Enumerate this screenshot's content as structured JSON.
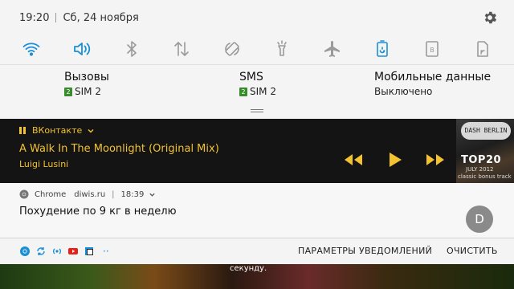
{
  "status_bar": {
    "time": "19:20",
    "date": "Сб, 24 ноября"
  },
  "quick_toggles": [
    {
      "icon": "wifi-icon",
      "active": true
    },
    {
      "icon": "sound-icon",
      "active": true
    },
    {
      "icon": "bluetooth-icon",
      "active": false
    },
    {
      "icon": "data-transfer-icon",
      "active": false
    },
    {
      "icon": "auto-rotate-icon",
      "active": false
    },
    {
      "icon": "flashlight-icon",
      "active": false
    },
    {
      "icon": "airplane-icon",
      "active": false
    },
    {
      "icon": "power-saving-icon",
      "active": true
    },
    {
      "icon": "blue-light-filter-icon",
      "active": false
    },
    {
      "icon": "screen-cast-icon",
      "active": false
    }
  ],
  "info_row": {
    "calls": {
      "title": "Вызовы",
      "sim": "SIM 2",
      "sim_num": "2"
    },
    "sms": {
      "title": "SMS",
      "sim": "SIM 2",
      "sim_num": "2"
    },
    "mobile_data": {
      "title": "Мобильные данные",
      "status": "Выключено"
    }
  },
  "media": {
    "app": "ВКонтакте",
    "title": "A Walk In The Moonlight (Original Mix)",
    "artist": "Luigi Lusini",
    "album_art": {
      "logo": "DASH BERLIN",
      "top": "TOP20",
      "date": "JULY 2012",
      "subtitle": "classic bonus track"
    }
  },
  "chrome_notification": {
    "app": "Chrome",
    "site": "diwis.ru",
    "time": "18:39",
    "text": "Похудение по 9 кг в неделю",
    "avatar_letter": "D"
  },
  "bottom_bar": {
    "settings_label": "ПАРАМЕТРЫ УВЕДОМЛЕНИЙ",
    "clear_label": "ОЧИСТИТЬ",
    "more": "··"
  },
  "wallpaper": {
    "caption": "секунду."
  },
  "colors": {
    "accent_blue": "#1a8fd6",
    "media_yellow": "#f2c230",
    "sim_green": "#3a8a2e"
  }
}
